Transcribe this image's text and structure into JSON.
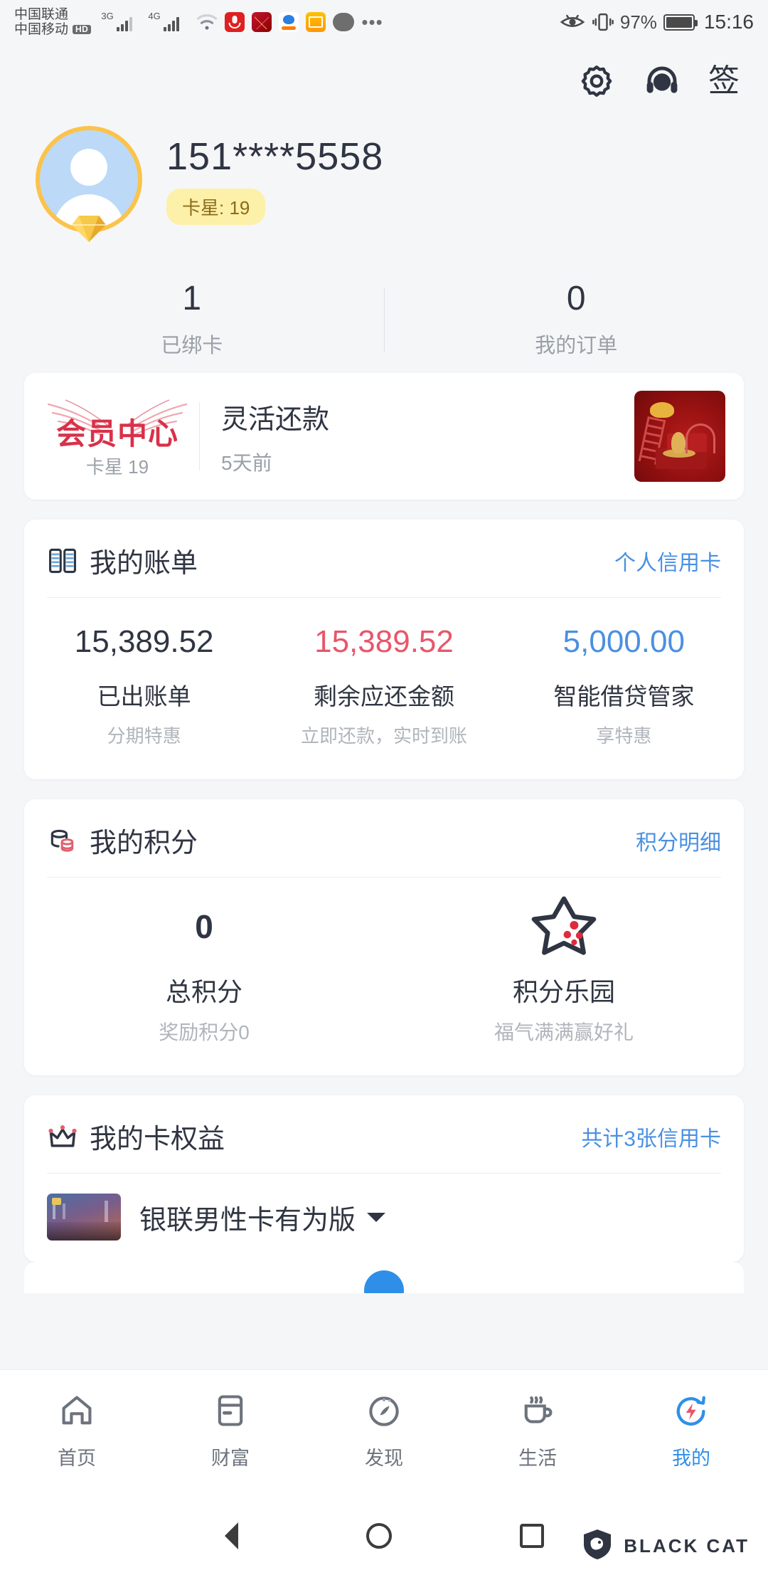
{
  "status_bar": {
    "carrier_primary": "中国联通",
    "carrier_secondary": "中国移动",
    "hd_badge": "HD",
    "net_primary": "3G",
    "net_secondary": "4G",
    "net_secondary_plus": "+",
    "battery_percent": "97%",
    "time": "15:16"
  },
  "header": {
    "settings_icon": "gear-icon",
    "support_icon": "headset-icon",
    "sign_in_label": "签"
  },
  "profile": {
    "phone_masked": "151****5558",
    "star_badge": "卡星: 19",
    "avatar_icon": "user-avatar-icon"
  },
  "stats": [
    {
      "value": "1",
      "label": "已绑卡"
    },
    {
      "value": "0",
      "label": "我的订单"
    }
  ],
  "member_banner": {
    "vip_title": "会员中心",
    "vip_sub": "卡星 19",
    "item_title": "灵活还款",
    "item_time": "5天前",
    "thumb_icon": "promo-thumbnail"
  },
  "bill_card": {
    "icon": "ledger-icon",
    "title": "我的账单",
    "link": "个人信用卡",
    "columns": [
      {
        "value": "15,389.52",
        "label": "已出账单",
        "sub": "分期特惠",
        "color": "#2f3542"
      },
      {
        "value": "15,389.52",
        "label": "剩余应还金额",
        "sub": "立即还款，实时到账",
        "color": "#e8566a"
      },
      {
        "value": "5,000.00",
        "label": "智能借贷管家",
        "sub": "享特惠",
        "color": "#4a90e2"
      }
    ]
  },
  "points_card": {
    "icon": "coins-icon",
    "title": "我的积分",
    "link": "积分明细",
    "total_value": "0",
    "total_label": "总积分",
    "total_sub": "奖励积分0",
    "park_icon": "star-icon",
    "park_label": "积分乐园",
    "park_sub": "福气满满赢好礼"
  },
  "benefits_card": {
    "icon": "crown-icon",
    "title": "我的卡权益",
    "link": "共计3张信用卡",
    "card_name": "银联男性卡有为版",
    "card_thumb": "credit-card-thumbnail",
    "caret_icon": "caret-down-icon"
  },
  "bottom_nav": [
    {
      "icon": "home-icon",
      "label": "首页",
      "active": false
    },
    {
      "icon": "card-icon",
      "label": "财富",
      "active": false
    },
    {
      "icon": "compass-icon",
      "label": "发现",
      "active": false
    },
    {
      "icon": "cup-icon",
      "label": "生活",
      "active": false
    },
    {
      "icon": "bolt-icon",
      "label": "我的",
      "active": true
    }
  ],
  "system_nav": {
    "back_icon": "back-triangle-icon",
    "home_icon": "home-circle-icon",
    "recents_icon": "recents-square-icon"
  },
  "watermark": {
    "text": "BLACK CAT",
    "logo_icon": "black-cat-logo"
  },
  "colors": {
    "accent_blue": "#4a90e2",
    "red": "#e8566a",
    "gold": "#fbc34a",
    "bg": "#f5f6f8"
  }
}
